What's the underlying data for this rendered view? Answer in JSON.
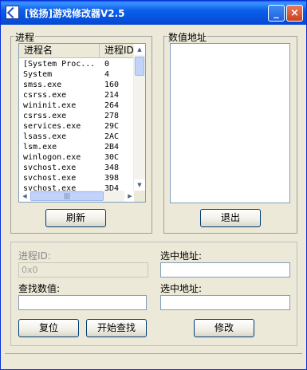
{
  "window": {
    "title": "[铭扬]游戏修改器V2.5"
  },
  "titlebar": {
    "min_glyph": "_",
    "max_glyph": "□",
    "close_glyph": "×"
  },
  "process_group": {
    "label": "进程",
    "columns": [
      "进程名",
      "进程ID"
    ],
    "rows": [
      [
        "[System Proc...",
        "0"
      ],
      [
        "System",
        "4"
      ],
      [
        "smss.exe",
        "160"
      ],
      [
        "csrss.exe",
        "214"
      ],
      [
        "wininit.exe",
        "264"
      ],
      [
        "csrss.exe",
        "278"
      ],
      [
        "services.exe",
        "29C"
      ],
      [
        "lsass.exe",
        "2AC"
      ],
      [
        "lsm.exe",
        "2B4"
      ],
      [
        "winlogon.exe",
        "30C"
      ],
      [
        "svchost.exe",
        "348"
      ],
      [
        "svchost.exe",
        "398"
      ],
      [
        "svchost.exe",
        "3D4"
      ]
    ],
    "refresh_label": "刷新"
  },
  "address_group": {
    "label": "数值地址",
    "exit_label": "退出"
  },
  "bottom": {
    "pid_label": "进程ID:",
    "pid_value": "0x0",
    "search_label": "查找数值:",
    "search_value": "",
    "selected_addr_label_1": "选中地址:",
    "selected_addr_label_2": "选中地址:",
    "addr_value_1": "",
    "addr_value_2": "",
    "reset_label": "复位",
    "start_search_label": "开始查找",
    "modify_label": "修改"
  },
  "scroll_glyphs": {
    "up": "▲",
    "down": "▼",
    "left": "◀",
    "right": "▶",
    "grip": "|||"
  }
}
